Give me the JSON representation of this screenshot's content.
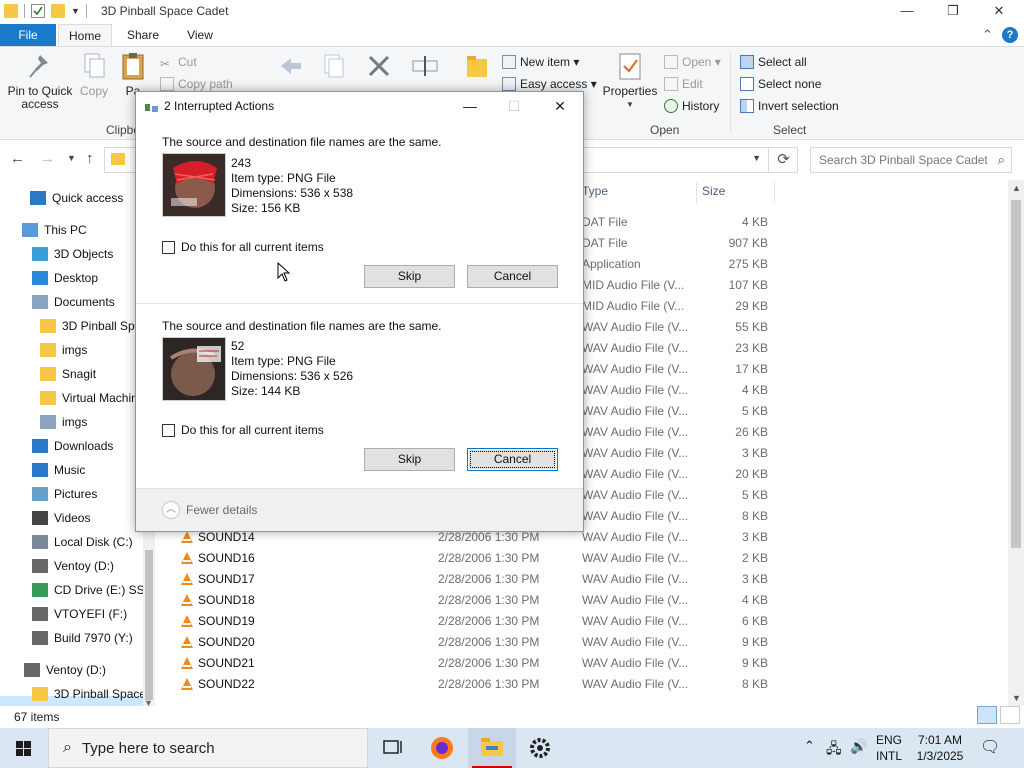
{
  "window": {
    "title": "3D Pinball Space Cadet",
    "minimize": "—",
    "maximize": "❐",
    "close": "✕"
  },
  "ribbon": {
    "tabs": [
      "File",
      "Home",
      "Share",
      "View"
    ],
    "pin_label_line1": "Pin to Quick",
    "pin_label_line2": "access",
    "copy_label": "Copy",
    "paste_label": "Pa",
    "cut_label": "Cut",
    "copy_path_label": "Copy path",
    "clipboard_group": "Clipbo",
    "new_item_label": "New item ▾",
    "easy_access_label": "Easy access ▾",
    "properties_label": "Properties",
    "open_label": "Open ▾",
    "edit_label": "Edit",
    "history_label": "History",
    "open_group": "Open",
    "select_all_label": "Select all",
    "select_none_label": "Select none",
    "invert_selection_label": "Invert selection",
    "select_group": "Select"
  },
  "addressbar": {
    "search_placeholder": "Search 3D Pinball Space Cadet"
  },
  "nav": {
    "items": [
      {
        "label": "Quick access",
        "icon": "star-icon"
      },
      {
        "label": "This PC",
        "icon": "computer-icon"
      },
      {
        "label": "3D Objects",
        "icon": "cube-icon"
      },
      {
        "label": "Desktop",
        "icon": "desktop-icon"
      },
      {
        "label": "Documents",
        "icon": "document-icon"
      },
      {
        "label": "3D Pinball Spa",
        "icon": "folder-icon"
      },
      {
        "label": "imgs",
        "icon": "folder-icon"
      },
      {
        "label": "Snagit",
        "icon": "folder-icon"
      },
      {
        "label": "Virtual Machin",
        "icon": "folder-icon"
      },
      {
        "label": "imgs",
        "icon": "document-icon"
      },
      {
        "label": "Downloads",
        "icon": "download-icon"
      },
      {
        "label": "Music",
        "icon": "music-icon"
      },
      {
        "label": "Pictures",
        "icon": "pictures-icon"
      },
      {
        "label": "Videos",
        "icon": "video-icon"
      },
      {
        "label": "Local Disk (C:)",
        "icon": "disk-icon"
      },
      {
        "label": "Ventoy (D:)",
        "icon": "drive-icon"
      },
      {
        "label": "CD Drive (E:) SSS",
        "icon": "cd-icon"
      },
      {
        "label": "VTOYEFI (F:)",
        "icon": "drive-icon"
      },
      {
        "label": "Build 7970 (Y:)",
        "icon": "drive-icon"
      },
      {
        "label": "Ventoy (D:)",
        "icon": "drive-icon"
      },
      {
        "label": "3D Pinball Space",
        "icon": "folder-icon"
      }
    ]
  },
  "columns": {
    "type": "Type",
    "size": "Size"
  },
  "files": [
    {
      "name": "",
      "date": "",
      "type": "DAT File",
      "size": "4 KB"
    },
    {
      "name": "",
      "date": "",
      "type": "DAT File",
      "size": "907 KB"
    },
    {
      "name": "",
      "date": "",
      "type": "Application",
      "size": "275 KB"
    },
    {
      "name": "",
      "date": "",
      "type": "MID Audio File (V...",
      "size": "107 KB"
    },
    {
      "name": "",
      "date": "",
      "type": "MID Audio File (V...",
      "size": "29 KB"
    },
    {
      "name": "",
      "date": "",
      "type": "WAV Audio File (V...",
      "size": "55 KB"
    },
    {
      "name": "",
      "date": "",
      "type": "WAV Audio File (V...",
      "size": "23 KB"
    },
    {
      "name": "",
      "date": "",
      "type": "WAV Audio File (V...",
      "size": "17 KB"
    },
    {
      "name": "",
      "date": "",
      "type": "WAV Audio File (V...",
      "size": "4 KB"
    },
    {
      "name": "",
      "date": "",
      "type": "WAV Audio File (V...",
      "size": "5 KB"
    },
    {
      "name": "",
      "date": "",
      "type": "WAV Audio File (V...",
      "size": "26 KB"
    },
    {
      "name": "",
      "date": "",
      "type": "WAV Audio File (V...",
      "size": "3 KB"
    },
    {
      "name": "",
      "date": "",
      "type": "WAV Audio File (V...",
      "size": "20 KB"
    },
    {
      "name": "",
      "date": "",
      "type": "WAV Audio File (V...",
      "size": "5 KB"
    },
    {
      "name": "",
      "date": "",
      "type": "WAV Audio File (V...",
      "size": "8 KB"
    },
    {
      "name": "SOUND14",
      "date": "2/28/2006 1:30 PM",
      "type": "WAV Audio File (V...",
      "size": "3 KB"
    },
    {
      "name": "SOUND16",
      "date": "2/28/2006 1:30 PM",
      "type": "WAV Audio File (V...",
      "size": "2 KB"
    },
    {
      "name": "SOUND17",
      "date": "2/28/2006 1:30 PM",
      "type": "WAV Audio File (V...",
      "size": "3 KB"
    },
    {
      "name": "SOUND18",
      "date": "2/28/2006 1:30 PM",
      "type": "WAV Audio File (V...",
      "size": "4 KB"
    },
    {
      "name": "SOUND19",
      "date": "2/28/2006 1:30 PM",
      "type": "WAV Audio File (V...",
      "size": "6 KB"
    },
    {
      "name": "SOUND20",
      "date": "2/28/2006 1:30 PM",
      "type": "WAV Audio File (V...",
      "size": "9 KB"
    },
    {
      "name": "SOUND21",
      "date": "2/28/2006 1:30 PM",
      "type": "WAV Audio File (V...",
      "size": "9 KB"
    },
    {
      "name": "SOUND22",
      "date": "2/28/2006 1:30 PM",
      "type": "WAV Audio File (V...",
      "size": "8 KB"
    }
  ],
  "status": {
    "item_count": "67 items"
  },
  "dialog": {
    "title": "2 Interrupted Actions",
    "minimize": "—",
    "maximize": "☐",
    "close": "✕",
    "conflicts": [
      {
        "message": "The source and destination file names are the same.",
        "file_name": "243",
        "item_type": "Item type: PNG File",
        "dimensions": "Dimensions: 536 x 538",
        "size": "Size: 156 KB",
        "checkbox_label": "Do this for all current items",
        "checked": false,
        "skip_label": "Skip",
        "cancel_label": "Cancel"
      },
      {
        "message": "The source and destination file names are the same.",
        "file_name": "52",
        "item_type": "Item type: PNG File",
        "dimensions": "Dimensions: 536 x 526",
        "size": "Size: 144 KB",
        "checkbox_label": "Do this for all current items",
        "checked": false,
        "skip_label": "Skip",
        "cancel_label": "Cancel"
      }
    ],
    "fewer_details": "Fewer details"
  },
  "taskbar": {
    "search_placeholder": "Type here to search",
    "language_line1": "ENG",
    "language_line2": "INTL",
    "time": "7:01 AM",
    "date": "1/3/2025"
  },
  "colors": {
    "accent": "#1979ca",
    "ribbon_bg": "#f5f6f7",
    "taskbar_bg": "#dbe6f3",
    "selection": "#cce8ff"
  }
}
